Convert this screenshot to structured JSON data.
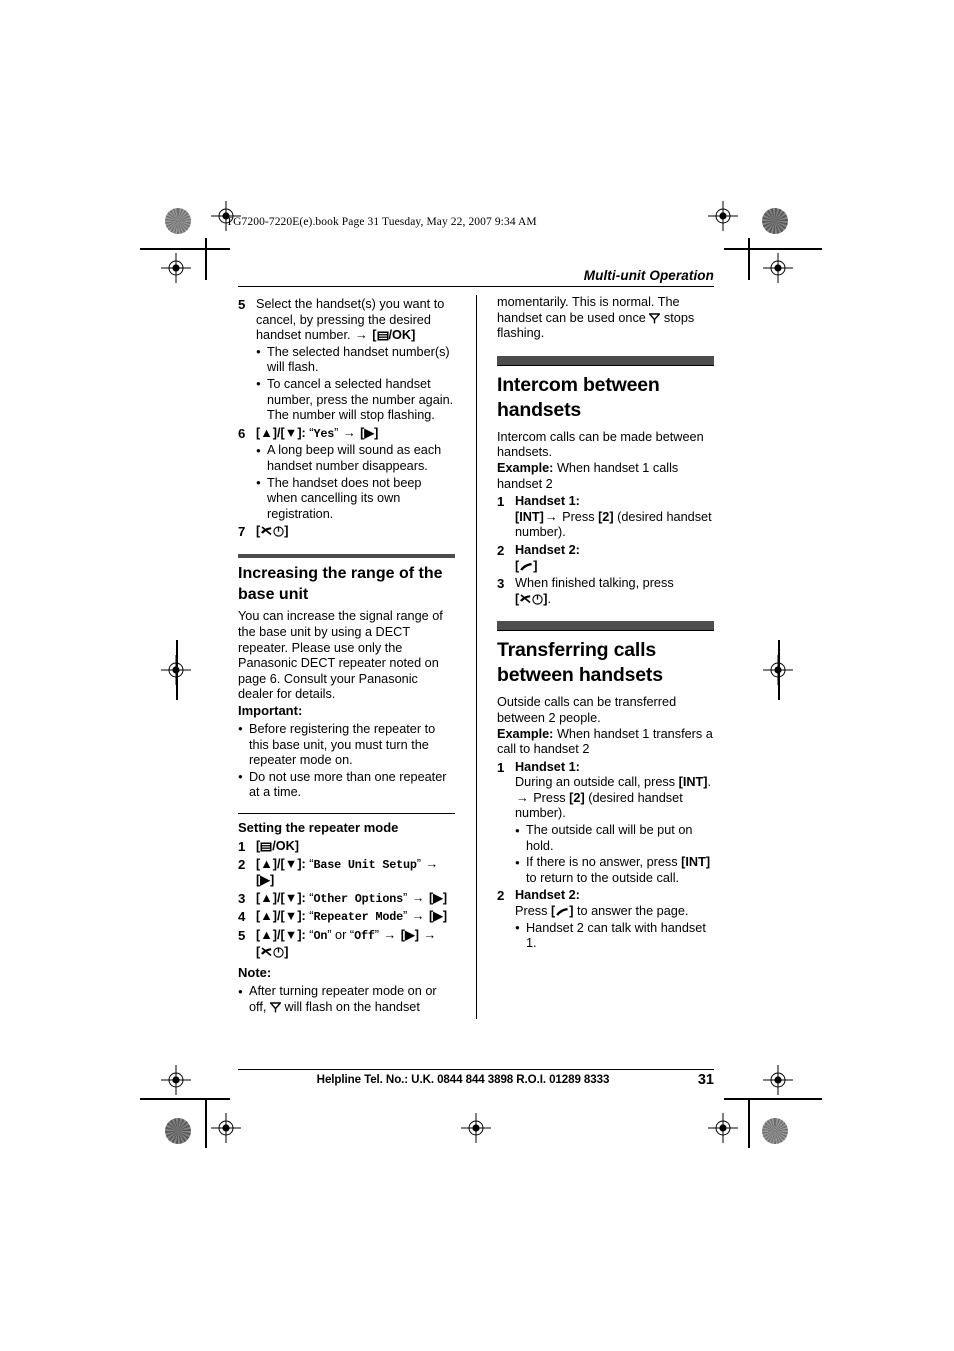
{
  "slug": "TG7200-7220E(e).book  Page 31  Tuesday, May 22, 2007  9:34 AM",
  "running_head": "Multi-unit Operation",
  "footer": {
    "helpline": "Helpline Tel. No.: U.K. 0844 844 3898 R.O.I. 01289 8333",
    "page_number": "31"
  },
  "left_column": {
    "step5": {
      "num": "5",
      "text_before": "Select the handset(s) you want to cancel, by pressing the desired handset number. ",
      "arrow": "→",
      "key": "/OK",
      "bullets": [
        "The selected handset number(s) will flash.",
        "To cancel a selected handset number, press the number again. The number will stop flashing."
      ]
    },
    "step6": {
      "num": "6",
      "updown": "[▲]/[▼]:",
      "lcd": "Yes",
      "arrow": "→",
      "key_right": "[▶]",
      "bullets": [
        "A long beep will sound as each handset number disappears.",
        "The handset does not beep when cancelling its own registration."
      ]
    },
    "step7": {
      "num": "7",
      "key_off": "off-key"
    },
    "range_section": {
      "title": "Increasing the range of the base unit",
      "body": "You can increase the signal range of the base unit by using a DECT repeater. Please use only the Panasonic DECT repeater noted on page 6. Consult your Panasonic dealer for details.",
      "important_label": "Important:",
      "important_bullets": [
        "Before registering the repeater to this base unit, you must turn the repeater mode on.",
        "Do not use more than one repeater at a time."
      ]
    },
    "repeater_section": {
      "title": "Setting the repeater mode",
      "steps": [
        {
          "num": "1",
          "type": "menu_ok"
        },
        {
          "num": "2",
          "type": "updown_lcd",
          "updown": "[▲]/[▼]:",
          "lcd": "Base Unit Setup",
          "arrow": "→",
          "key_right": "[▶]"
        },
        {
          "num": "3",
          "type": "updown_lcd",
          "updown": "[▲]/[▼]:",
          "lcd": "Other Options",
          "arrow": "→",
          "key_right": "[▶]"
        },
        {
          "num": "4",
          "type": "updown_lcd",
          "updown": "[▲]/[▼]:",
          "lcd": "Repeater Mode",
          "arrow": "→",
          "key_right": "[▶]"
        },
        {
          "num": "5",
          "type": "onoff",
          "updown": "[▲]/[▼]:",
          "lcd_on": "On",
          "or": " or ",
          "lcd_off": "Off",
          "arrow": "→",
          "key_right": "[▶]"
        }
      ],
      "note_label": "Note:",
      "note_before": "After turning repeater mode on or off, ",
      "note_after": " will flash on the handset"
    }
  },
  "right_column": {
    "continuation": "momentarily. This is normal. The handset can be used once",
    "continuation_after": "stops flashing.",
    "intercom_section": {
      "title": "Intercom between handsets",
      "body": "Intercom calls can be made between handsets.",
      "example_label": "Example:",
      "example_text": " When handset 1 calls handset 2",
      "steps": [
        {
          "num": "1",
          "head": "Handset 1:",
          "key_int": "[INT]",
          "arrow": "→",
          "press": " Press ",
          "key_two": "[2]",
          "tail": " (desired handset number)."
        },
        {
          "num": "2",
          "head": "Handset 2:",
          "talk_key": "talk-key"
        },
        {
          "num": "3",
          "text": "When finished talking, press",
          "off_key": "off-key"
        }
      ]
    },
    "transfer_section": {
      "title": "Transferring calls between handsets",
      "body": "Outside calls can be transferred between 2 people.",
      "example_label": "Example:",
      "example_text": " When handset 1 transfers a call to handset 2",
      "step1": {
        "num": "1",
        "head": "Handset 1:",
        "line1": "During an outside call, press ",
        "key_int": "[INT]",
        "period": ".",
        "arrow": "→",
        "press": " Press ",
        "key_two": "[2]",
        "tail": " (desired handset number).",
        "bullet1": "The outside call will be put on hold.",
        "bullet2_before": "If there is no answer, press ",
        "bullet2_key": "[INT]",
        "bullet2_after": " to return to the outside call."
      },
      "step2": {
        "num": "2",
        "head": "Handset 2:",
        "press_before": "Press ",
        "press_after": " to answer the page.",
        "bullet": "Handset 2 can talk with handset 1."
      }
    }
  },
  "colors": {
    "section_bar": "#4d4d4d",
    "text": "#000000",
    "page_background": "#ffffff"
  }
}
